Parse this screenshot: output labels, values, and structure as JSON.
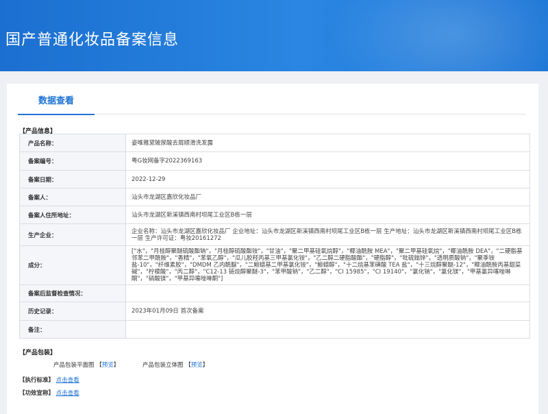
{
  "header": {
    "title": "国产普通化妆品备案信息"
  },
  "tabs": [
    {
      "label": "数据查看"
    }
  ],
  "product_info": {
    "section_title": "【产品信息】",
    "rows": [
      {
        "label": "产品名称：",
        "value": "姿唯雅黛玻尿酸去屑顺滑洗发露"
      },
      {
        "label": "备案编号：",
        "value": "粤G妆网备字2022369163"
      },
      {
        "label": "备案日期：",
        "value": "2022-12-29"
      },
      {
        "label": "备案人：",
        "value": "汕头市龙湖区嘉欣化妆品厂"
      },
      {
        "label": "备案人住所地址：",
        "value": "汕头市龙湖区新溪镇西南村坝尾工业区B栋一层"
      },
      {
        "label": "生产企业：",
        "value": "企业名称：汕头市龙湖区嘉欣化妆品厂 企业地址：汕头市龙湖区新溪镇西南村坝尾工业区B栋一层 生产地址：汕头市龙湖区新溪镇西南村坝尾工业区B栋一层 生产许可证：粤妆20161272"
      },
      {
        "label": "成分：",
        "value": "[\"水\"，\"月桂醇聚醚硫酸酯钠\"，\"月桂醇硫酸酯铵\"，\"甘油\"，\"聚二甲基硅氧烷醇\"，\"椰油酰胺 MEA\"，\"聚二甲基硅氧烷\"，\"椰油酰胺 DEA\"，\"二硬脂基邻苯二甲酰胺\"，\"香精\"，\"苯氧乙醇\"，\"瓜儿胶羟丙基三甲基氯化铵\"，\"乙二醇二硬脂酸酯\"，\"硬脂醇\"，\"吡硫鎓锌\"，\"透明质酸钠\"，\"聚季铵盐-10\"，\"纤维素胶\"，\"DMDM 乙内酰脲\"，\"二鲸蜡基二甲基氯化铵\"，\"鲸蜡醇\"，\"十二烷基苯磺酸 TEA 盐\"，\"十三烷醇聚醚-12\"，\"椰油酰胺丙基甜菜碱\"，\"柠檬酸\"，\"丙二醇\"，\"C12-13 链烷醇聚醚-3\"，\"苯甲酸钠\"，\"乙二醇\"，\"CI 15985\"，\"CI 19140\"，\"氯化钠\"，\"氯化镁\"，\"甲基氯异噻唑啉酮\"，\"硝酸镁\"，\"甲基异噻唑啉酮\"]"
      },
      {
        "label": "备案后监督检查情况：",
        "value": ""
      },
      {
        "label": "历史记录：",
        "value": "2023年01月09日 首次备案"
      },
      {
        "label": "备注：",
        "value": ""
      }
    ]
  },
  "packaging": {
    "section_title": "【产品包装】",
    "flat_label": "产品包装平面图",
    "flat_link": "预览",
    "stereo_label": "产品包装立体图",
    "stereo_link": "预览"
  },
  "standard": {
    "section_title": "【执行标准】",
    "link": "点击查看"
  },
  "claims": {
    "section_title": "【功效宣称】",
    "link": "点击查看"
  }
}
